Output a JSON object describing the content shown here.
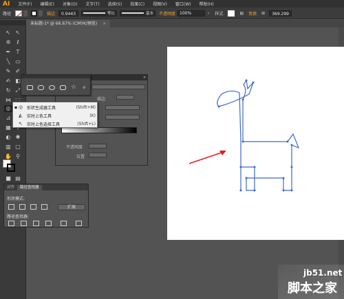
{
  "menubar": {
    "logo": "AI",
    "items": [
      "文件(F)",
      "编辑(E)",
      "对象(O)",
      "文字(T)",
      "选择(S)",
      "效果(C)",
      "视图(V)",
      "窗口(W)",
      "帮助(H)"
    ]
  },
  "control_bar": {
    "label_path": "路径",
    "stroke_label": "描边",
    "stroke_value": "0.9443",
    "stroke_style_1": "等比",
    "stroke_style_2": "基本",
    "opacity_label": "不透明度",
    "opacity_value": "100%",
    "style_label": "样式",
    "transform_label": "变换",
    "coord_value": "369.299"
  },
  "document_tab": {
    "title": "未标题-1* @ 66.67% (CMYK/预览)",
    "close": "×"
  },
  "props_panel": {
    "stroke_label": "描边",
    "opacity_label": "不透明度",
    "position_label": "位置"
  },
  "context_menu": {
    "items": [
      {
        "bullet": "▪",
        "label": "形状生成器工具",
        "shortcut": "(Shift+M)"
      },
      {
        "bullet": "",
        "label": "实时上色工具",
        "shortcut": "(K)"
      },
      {
        "bullet": "",
        "label": "实时上色选择工具",
        "shortcut": "(Shift+L)"
      }
    ]
  },
  "pathfinder_panel": {
    "tabs": [
      "对齐",
      "路径查找器"
    ],
    "shape_modes_label": "形状模式:",
    "expand_button": "扩展",
    "pathfinders_label": "路径查找器:"
  },
  "watermark": {
    "domain": "jb51.net",
    "brand": "脚本之家"
  },
  "colors": {
    "giraffe_stroke": "#3c68c9",
    "arrow": "#e02020",
    "accent_orange": "#f0a030"
  }
}
